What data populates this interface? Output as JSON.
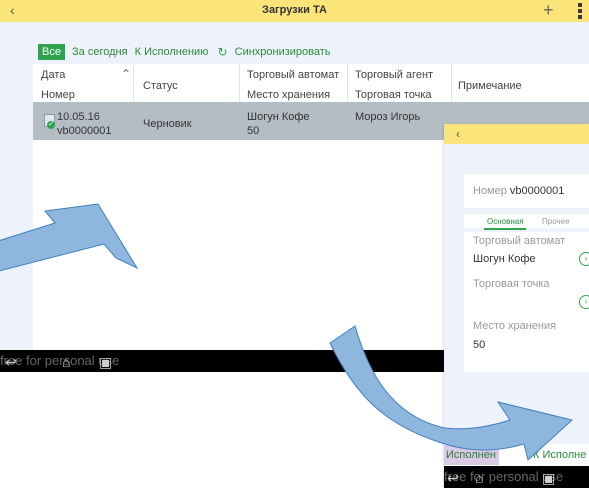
{
  "tablet": {
    "header": {
      "back_icon": "chevron-left-icon",
      "title": "Загрузки ТА",
      "add_icon": "plus-icon",
      "menu_icon": "kebab-menu-icon"
    },
    "filters": {
      "all": "Все",
      "today": "За сегодня",
      "to_execute": "К Исполнению",
      "sync": "Синхронизировать"
    },
    "columns": {
      "date": "Дата",
      "number": "Номер",
      "status": "Статус",
      "vending_machine": "Торговый автомат",
      "storage": "Место хранения",
      "agent": "Торговый агент",
      "point": "Торговая точка",
      "note": "Примечание"
    },
    "rows": [
      {
        "date": "10.05.16",
        "number": "vb0000001",
        "status": "Черновик",
        "vending_machine": "Шогун Кофе",
        "storage": "50",
        "agent": "Мороз Игорь",
        "point": "",
        "note": ""
      }
    ],
    "watermark": "free for personal use"
  },
  "phone": {
    "header": {
      "back_icon": "chevron-left-icon"
    },
    "number_label": "Номер",
    "number_value": "vb0000001",
    "tabs": {
      "main": "Основная",
      "other": "Прочее"
    },
    "fields": {
      "vending_machine_label": "Торговый автомат",
      "vending_machine_value": "Шогун Кофе",
      "point_label": "Торговая точка",
      "point_value": "",
      "storage_label": "Место хранения",
      "storage_value": "50"
    },
    "actions": {
      "executed": "Исполнен",
      "to_execute": "К Исполне"
    },
    "watermark": "free for personal use"
  },
  "colors": {
    "header": "#fbe57a",
    "accent_green": "#2ea44f",
    "selected_row": "#b4bcc4",
    "background": "#eef3fb",
    "arrow_fill": "#8fb7dd"
  }
}
